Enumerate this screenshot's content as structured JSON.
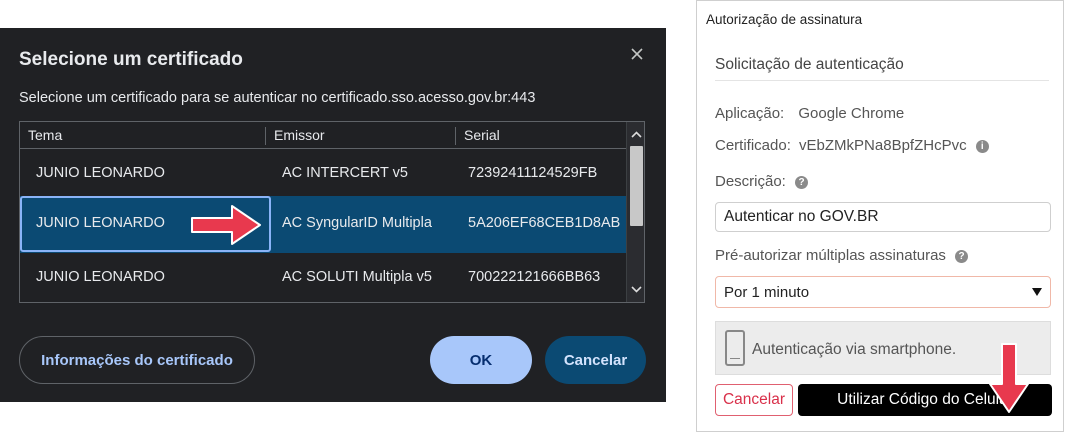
{
  "cert_dialog": {
    "title": "Selecione um certificado",
    "subtitle": "Selecione um certificado para se autenticar no certificado.sso.acesso.gov.br:443",
    "columns": [
      "Tema",
      "Emissor",
      "Serial"
    ],
    "rows": [
      {
        "tema": "JUNIO LEONARDO",
        "emissor": "AC INTERCERT v5",
        "serial": "72392411124529FB",
        "selected": false
      },
      {
        "tema": "JUNIO LEONARDO",
        "emissor": "AC SyngularID Multipla",
        "serial": "5A206EF68CEB1D8AB",
        "selected": true
      },
      {
        "tema": "JUNIO LEONARDO",
        "emissor": "AC SOLUTI Multipla v5",
        "serial": "700222121666BB63",
        "selected": false
      }
    ],
    "buttons": {
      "info": "Informações do certificado",
      "ok": "OK",
      "cancel": "Cancelar"
    },
    "close_icon": "close-icon",
    "colors": {
      "background": "#202124",
      "selected_row": "#0b4a73",
      "ok_button": "#a8c7fa",
      "annotation_arrow": "#e8394e"
    }
  },
  "sign_window": {
    "title": "Autorização de assinatura",
    "panel_title": "Solicitação de autenticação",
    "aplicacao_label": "Aplicação:",
    "aplicacao_value": "Google Chrome",
    "certificado_label": "Certificado:",
    "certificado_value": "vEbZMkPNa8BpfZHcPvc",
    "descricao_label": "Descrição:",
    "descricao_value": "Autenticar no GOV.BR",
    "preauth_label": "Pré-autorizar múltiplas assinaturas",
    "preauth_selected": "Por 1 minuto",
    "smartphone_label": "Autenticação via smartphone.",
    "cancel_button": "Cancelar",
    "primary_button": "Utilizar Código do Celular",
    "help_icon": "info-icon",
    "colors": {
      "primary_button": "#000000",
      "cancel_border": "#e06070"
    }
  }
}
